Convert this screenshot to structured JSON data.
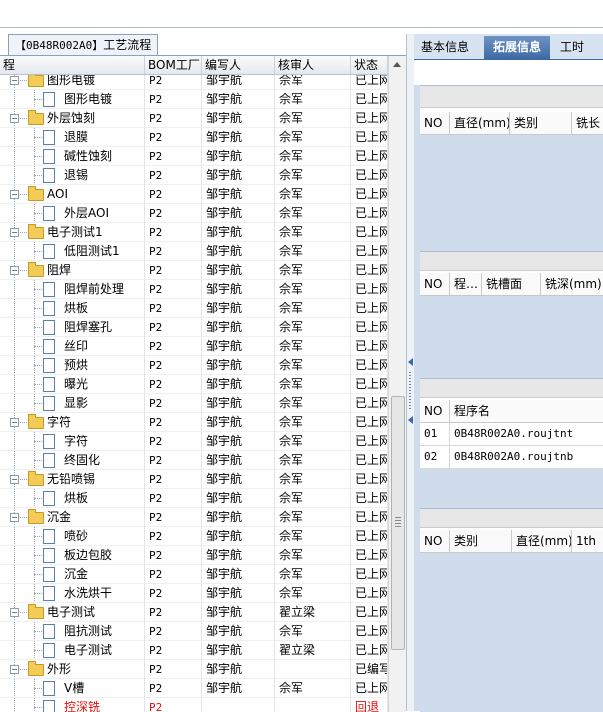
{
  "left_tab": {
    "code": "【0B48R002A0】",
    "title": "工艺流程"
  },
  "columns": {
    "process": "程",
    "bom": "BOM工厂",
    "writer": "编写人",
    "reviewer": "核审人",
    "status": "状态"
  },
  "rows": [
    {
      "level": 1,
      "icon": "folder",
      "name": "图形电镀",
      "bom": "P2",
      "writer": "邹宇航",
      "reviewer": "佘军",
      "status": "已上网"
    },
    {
      "level": 2,
      "icon": "doc",
      "name": "图形电镀",
      "bom": "P2",
      "writer": "邹宇航",
      "reviewer": "佘军",
      "status": "已上网"
    },
    {
      "level": 1,
      "icon": "folder",
      "name": "外层蚀刻",
      "bom": "P2",
      "writer": "邹宇航",
      "reviewer": "佘军",
      "status": "已上网"
    },
    {
      "level": 2,
      "icon": "doc",
      "name": "退膜",
      "bom": "P2",
      "writer": "邹宇航",
      "reviewer": "佘军",
      "status": "已上网"
    },
    {
      "level": 2,
      "icon": "doc",
      "name": "碱性蚀刻",
      "bom": "P2",
      "writer": "邹宇航",
      "reviewer": "佘军",
      "status": "已上网"
    },
    {
      "level": 2,
      "icon": "doc",
      "name": "退锡",
      "bom": "P2",
      "writer": "邹宇航",
      "reviewer": "佘军",
      "status": "已上网"
    },
    {
      "level": 1,
      "icon": "folder",
      "name": "AOI",
      "bom": "P2",
      "writer": "邹宇航",
      "reviewer": "佘军",
      "status": "已上网"
    },
    {
      "level": 2,
      "icon": "doc",
      "name": "外层AOI",
      "bom": "P2",
      "writer": "邹宇航",
      "reviewer": "佘军",
      "status": "已上网"
    },
    {
      "level": 1,
      "icon": "folder",
      "name": "电子测试1",
      "bom": "P2",
      "writer": "邹宇航",
      "reviewer": "佘军",
      "status": "已上网"
    },
    {
      "level": 2,
      "icon": "doc",
      "name": "低阻测试1",
      "bom": "P2",
      "writer": "邹宇航",
      "reviewer": "佘军",
      "status": "已上网"
    },
    {
      "level": 1,
      "icon": "folder",
      "name": "阻焊",
      "bom": "P2",
      "writer": "邹宇航",
      "reviewer": "佘军",
      "status": "已上网"
    },
    {
      "level": 2,
      "icon": "doc",
      "name": "阻焊前处理",
      "bom": "P2",
      "writer": "邹宇航",
      "reviewer": "佘军",
      "status": "已上网"
    },
    {
      "level": 2,
      "icon": "doc",
      "name": "烘板",
      "bom": "P2",
      "writer": "邹宇航",
      "reviewer": "佘军",
      "status": "已上网"
    },
    {
      "level": 2,
      "icon": "doc",
      "name": "阻焊塞孔",
      "bom": "P2",
      "writer": "邹宇航",
      "reviewer": "佘军",
      "status": "已上网"
    },
    {
      "level": 2,
      "icon": "doc",
      "name": "丝印",
      "bom": "P2",
      "writer": "邹宇航",
      "reviewer": "佘军",
      "status": "已上网"
    },
    {
      "level": 2,
      "icon": "doc",
      "name": "预烘",
      "bom": "P2",
      "writer": "邹宇航",
      "reviewer": "佘军",
      "status": "已上网"
    },
    {
      "level": 2,
      "icon": "doc",
      "name": "曝光",
      "bom": "P2",
      "writer": "邹宇航",
      "reviewer": "佘军",
      "status": "已上网"
    },
    {
      "level": 2,
      "icon": "doc",
      "name": "显影",
      "bom": "P2",
      "writer": "邹宇航",
      "reviewer": "佘军",
      "status": "已上网"
    },
    {
      "level": 1,
      "icon": "folder",
      "name": "字符",
      "bom": "P2",
      "writer": "邹宇航",
      "reviewer": "佘军",
      "status": "已上网"
    },
    {
      "level": 2,
      "icon": "doc",
      "name": "字符",
      "bom": "P2",
      "writer": "邹宇航",
      "reviewer": "佘军",
      "status": "已上网"
    },
    {
      "level": 2,
      "icon": "doc",
      "name": "终固化",
      "bom": "P2",
      "writer": "邹宇航",
      "reviewer": "佘军",
      "status": "已上网"
    },
    {
      "level": 1,
      "icon": "folder",
      "name": "无铅喷锡",
      "bom": "P2",
      "writer": "邹宇航",
      "reviewer": "佘军",
      "status": "已上网"
    },
    {
      "level": 2,
      "icon": "doc",
      "name": "烘板",
      "bom": "P2",
      "writer": "邹宇航",
      "reviewer": "佘军",
      "status": "已上网"
    },
    {
      "level": 1,
      "icon": "folder",
      "name": "沉金",
      "bom": "P2",
      "writer": "邹宇航",
      "reviewer": "佘军",
      "status": "已上网"
    },
    {
      "level": 2,
      "icon": "doc",
      "name": "喷砂",
      "bom": "P2",
      "writer": "邹宇航",
      "reviewer": "佘军",
      "status": "已上网"
    },
    {
      "level": 2,
      "icon": "doc",
      "name": "板边包胶",
      "bom": "P2",
      "writer": "邹宇航",
      "reviewer": "佘军",
      "status": "已上网"
    },
    {
      "level": 2,
      "icon": "doc",
      "name": "沉金",
      "bom": "P2",
      "writer": "邹宇航",
      "reviewer": "佘军",
      "status": "已上网"
    },
    {
      "level": 2,
      "icon": "doc",
      "name": "水洗烘干",
      "bom": "P2",
      "writer": "邹宇航",
      "reviewer": "佘军",
      "status": "已上网"
    },
    {
      "level": 1,
      "icon": "folder",
      "name": "电子测试",
      "bom": "P2",
      "writer": "邹宇航",
      "reviewer": "翟立梁",
      "status": "已上网"
    },
    {
      "level": 2,
      "icon": "doc",
      "name": "阻抗测试",
      "bom": "P2",
      "writer": "邹宇航",
      "reviewer": "佘军",
      "status": "已上网"
    },
    {
      "level": 2,
      "icon": "doc",
      "name": "电子测试",
      "bom": "P2",
      "writer": "邹宇航",
      "reviewer": "翟立梁",
      "status": "已上网"
    },
    {
      "level": 1,
      "icon": "folder",
      "name": "外形",
      "bom": "P2",
      "writer": "邹宇航",
      "reviewer": "",
      "status": "已编写"
    },
    {
      "level": 2,
      "icon": "doc",
      "name": "V槽",
      "bom": "P2",
      "writer": "邹宇航",
      "reviewer": "佘军",
      "status": "已上网"
    },
    {
      "level": 2,
      "icon": "doc",
      "name": "控深铣",
      "bom": "P2",
      "writer": "",
      "reviewer": "",
      "status": "回退",
      "red": true
    }
  ],
  "right_tabs": [
    "基本信息",
    "拓展信息",
    "工时"
  ],
  "active_right_tab": "拓展信息",
  "panel1": {
    "headers": [
      "NO",
      "直径(mm)",
      "类别",
      "铣长"
    ]
  },
  "panel2": {
    "headers": [
      "NO",
      "程…",
      "铣槽面",
      "铣深(mm)"
    ]
  },
  "panel3": {
    "headers": [
      "NO",
      "程序名"
    ],
    "rows": [
      [
        "01",
        "0B48R002A0.roujtnt"
      ],
      [
        "02",
        "0B48R002A0.roujtnb"
      ]
    ]
  },
  "panel4": {
    "headers": [
      "NO",
      "类别",
      "直径(mm)",
      "1th"
    ]
  }
}
